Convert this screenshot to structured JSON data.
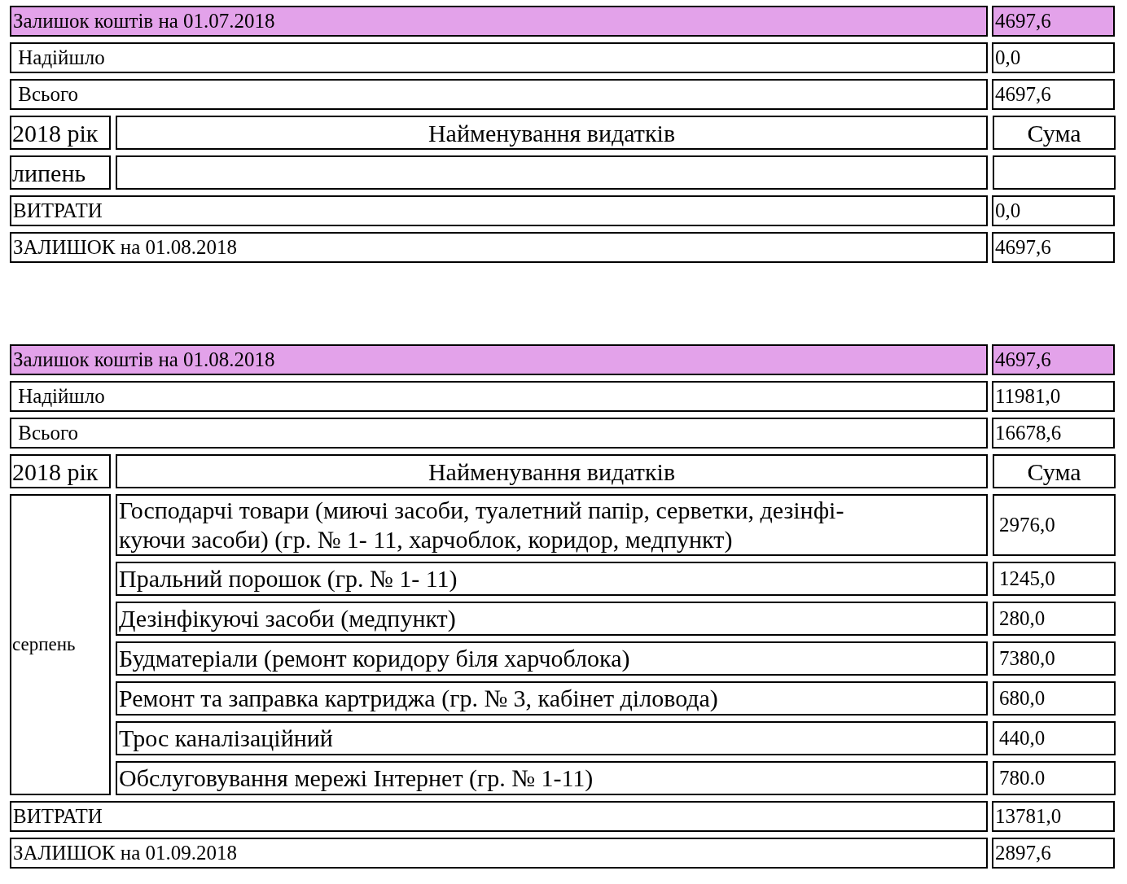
{
  "tables": [
    {
      "rows": [
        {
          "kind": "summary",
          "label": "Залишок коштів на 01.07.2018",
          "amount": "4697,6",
          "highlighted": true
        },
        {
          "kind": "summary",
          "label": " Надійшло",
          "amount": "0,0",
          "highlighted": false
        },
        {
          "kind": "summary",
          "label": " Всього",
          "amount": "4697,6",
          "highlighted": false
        },
        {
          "kind": "header",
          "year": "2018 рік",
          "name": "Найменування видатків",
          "sum": "Сума"
        },
        {
          "kind": "month",
          "month": "липень"
        },
        {
          "kind": "summary",
          "label": "ВИТРАТИ",
          "amount": "0,0",
          "highlighted": false
        },
        {
          "kind": "summary",
          "label": "ЗАЛИШОК на 01.08.2018",
          "amount": "4697,6",
          "highlighted": false
        }
      ]
    },
    {
      "rows": [
        {
          "kind": "summary",
          "label": "Залишок коштів на 01.08.2018",
          "amount": "4697,6",
          "highlighted": true
        },
        {
          "kind": "summary",
          "label": " Надійшло",
          "amount": "11981,0",
          "highlighted": false
        },
        {
          "kind": "summary",
          "label": " Всього",
          "amount": "16678,6",
          "highlighted": false
        },
        {
          "kind": "header",
          "year": "2018 рік",
          "name": "Найменування видатків",
          "sum": "Сума"
        },
        {
          "kind": "month",
          "month": "серпень",
          "items": [
            {
              "name": "Господарчі товари (миючі засоби, туалетний папір, серветки, дезінфі-\nкуючи засоби)  (гр. № 1- 11, харчоблок, коридор, медпункт)",
              "amount": "2976,0"
            },
            {
              "name": "Пральний порошок  (гр. № 1- 11)",
              "amount": "1245,0"
            },
            {
              "name": "Дезінфікуючі засоби (медпункт)",
              "amount": "280,0"
            },
            {
              "name": "Будматеріали (ремонт коридору біля харчоблока)",
              "amount": "7380,0"
            },
            {
              "name": "Ремонт та заправка картриджа (гр. № 3, кабінет діловода)",
              "amount": "680,0"
            },
            {
              "name": "Трос каналізаційний",
              "amount": "440,0"
            },
            {
              "name": "Обслуговування мережі Інтернет (гр. № 1-11)",
              "amount": "780.0"
            }
          ]
        },
        {
          "kind": "summary",
          "label": "ВИТРАТИ",
          "amount": "13781,0",
          "highlighted": false
        },
        {
          "kind": "summary",
          "label": "ЗАЛИШОК на 01.09.2018",
          "amount": "2897,6",
          "highlighted": false
        }
      ]
    }
  ]
}
